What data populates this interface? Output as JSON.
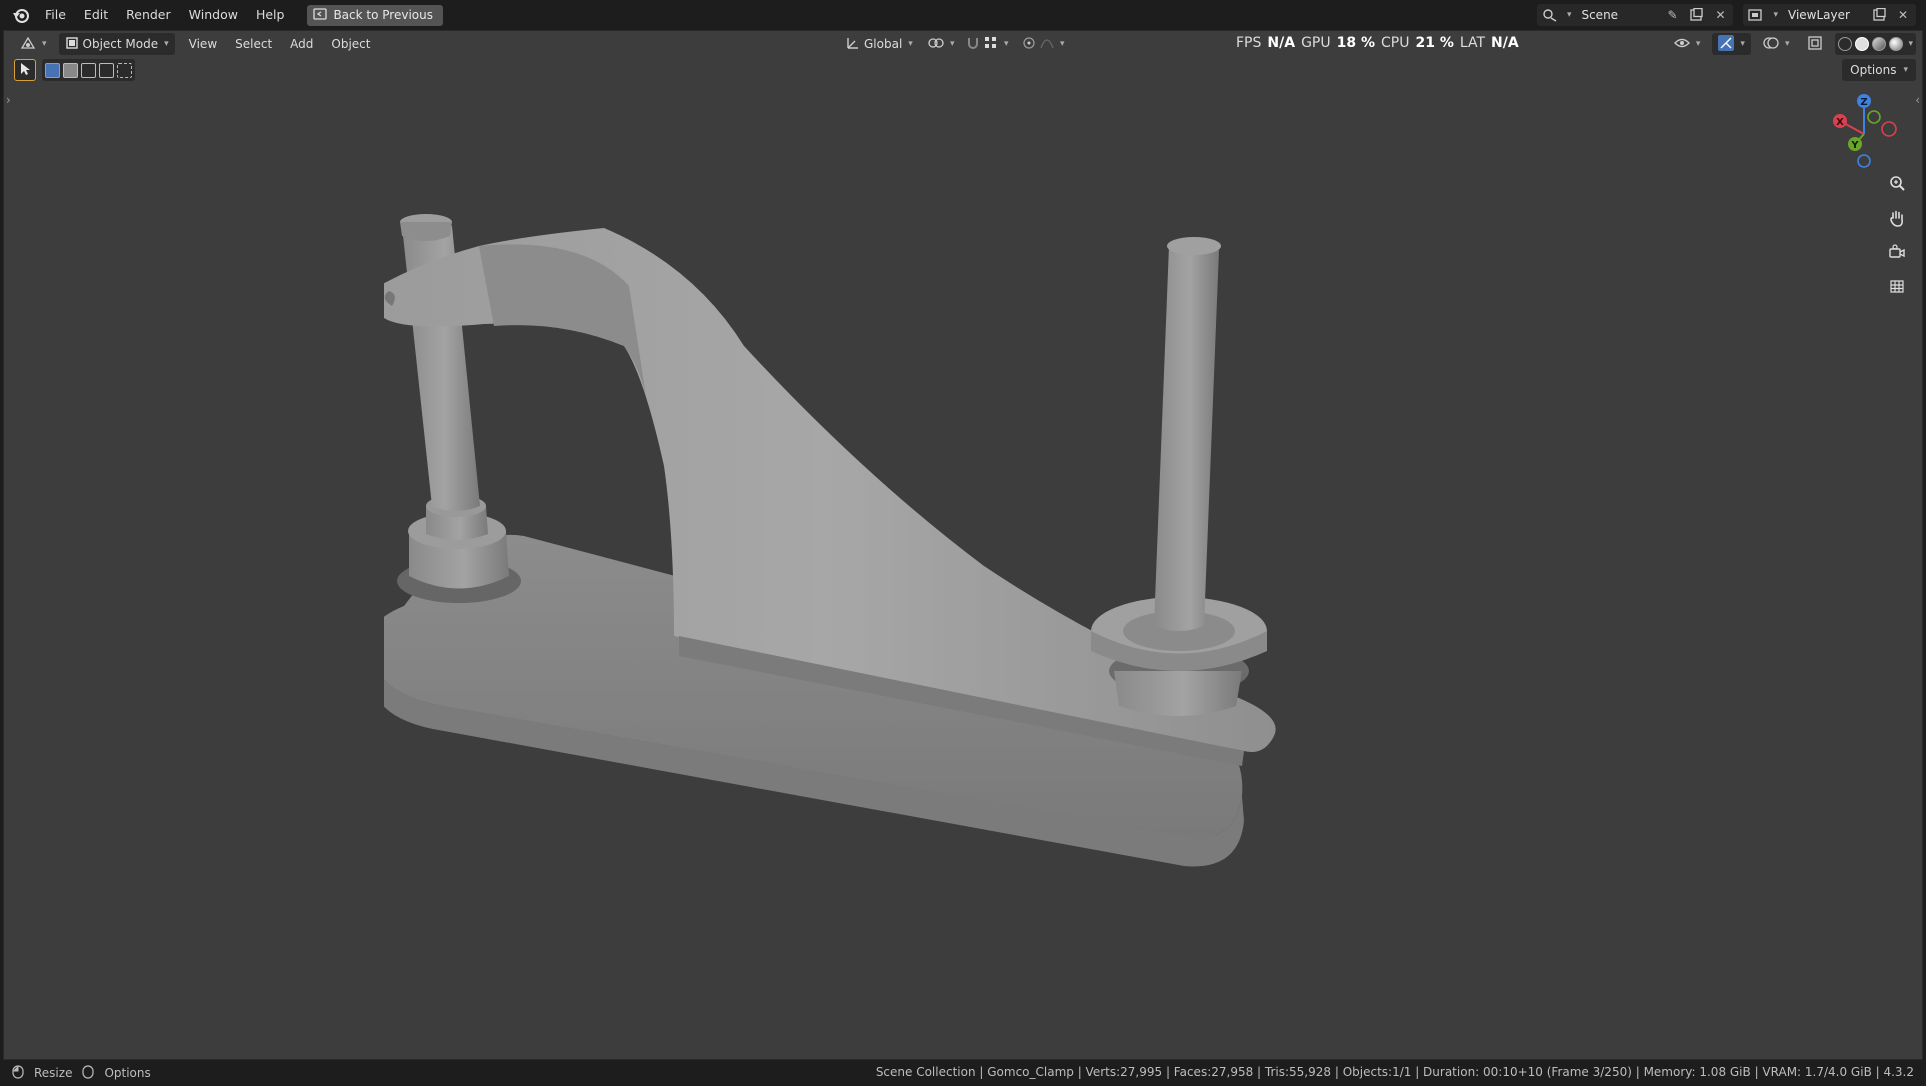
{
  "menu": {
    "items": [
      "File",
      "Edit",
      "Render",
      "Window",
      "Help"
    ],
    "back_label": "Back to Previous"
  },
  "scene": {
    "name": "Scene",
    "view_layer": "ViewLayer"
  },
  "viewport_header": {
    "mode": "Object Mode",
    "menus": [
      "View",
      "Select",
      "Add",
      "Object"
    ],
    "transform_orientation": "Global",
    "options_label": "Options"
  },
  "stats": {
    "fps_label": "FPS",
    "fps_value": "N/A",
    "gpu_label": "GPU",
    "gpu_value": "18 %",
    "cpu_label": "CPU",
    "cpu_value": "21 %",
    "lat_label": "LAT",
    "lat_value": "N/A"
  },
  "gizmo": {
    "x": "X",
    "y": "Y",
    "z": "Z"
  },
  "colors": {
    "x_axis": "#d9414f",
    "y_axis": "#6aa629",
    "z_axis": "#3f82e0",
    "viewport_bg": "#3d3d3d"
  },
  "statusbar": {
    "left": [
      "Resize",
      "Options"
    ],
    "info": "Scene Collection | Gomco_Clamp | Verts:27,995 | Faces:27,958 | Tris:55,928 | Objects:1/1 | Duration: 00:10+10 (Frame 3/250) | Memory: 1.08 GiB | VRAM: 1.7/4.0 GiB | 4.3.2"
  }
}
